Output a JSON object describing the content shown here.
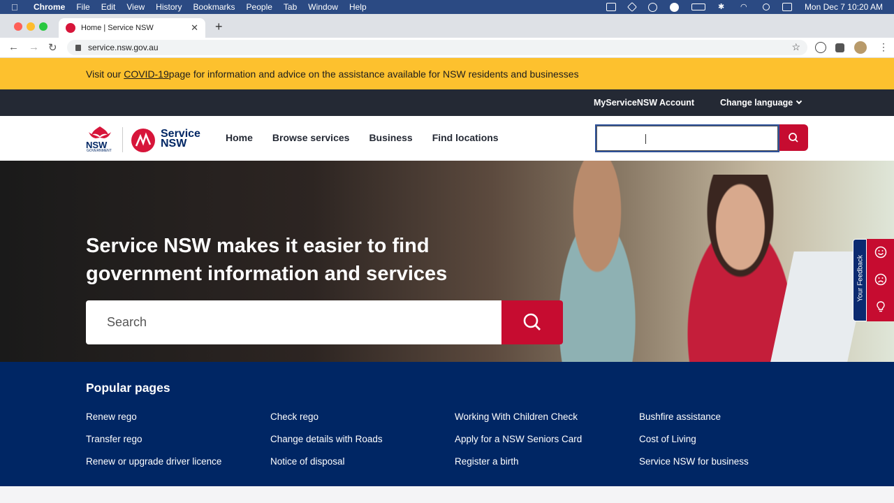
{
  "os_menubar": {
    "app": "Chrome",
    "menus": [
      "File",
      "Edit",
      "View",
      "History",
      "Bookmarks",
      "People",
      "Tab",
      "Window",
      "Help"
    ],
    "clock": "Mon Dec 7  10:20 AM"
  },
  "browser": {
    "tab_title": "Home | Service NSW",
    "url": "service.nsw.gov.au"
  },
  "covid_banner": {
    "prefix": "Visit our ",
    "link": "COVID-19",
    "suffix": " page for information and advice on the assistance available for NSW residents and businesses"
  },
  "utility_nav": {
    "account": "MyServiceNSW Account",
    "language": "Change language"
  },
  "header": {
    "nsw_logo_text": "NSW",
    "nsw_logo_sub": "GOVERNMENT",
    "brand_line1": "Service",
    "brand_line2": "NSW",
    "nav": [
      "Home",
      "Browse services",
      "Business",
      "Find locations"
    ]
  },
  "hero": {
    "title": "Service NSW makes it easier to find government information and services",
    "search_placeholder": "Search"
  },
  "feedback": {
    "label": "Your Feedback"
  },
  "popular": {
    "heading": "Popular pages",
    "links": [
      "Renew rego",
      "Check rego",
      "Working With Children Check",
      "Bushfire assistance",
      "Transfer rego",
      "Change details with Roads",
      "Apply for a NSW Seniors Card",
      "Cost of Living",
      "Renew or upgrade driver licence",
      "Notice of disposal",
      "Register a birth",
      "Service NSW for business"
    ]
  },
  "colors": {
    "nsw_red": "#c60c30",
    "nsw_navy": "#002664",
    "banner_yellow": "#fdc12e",
    "utility_dark": "#242934"
  }
}
